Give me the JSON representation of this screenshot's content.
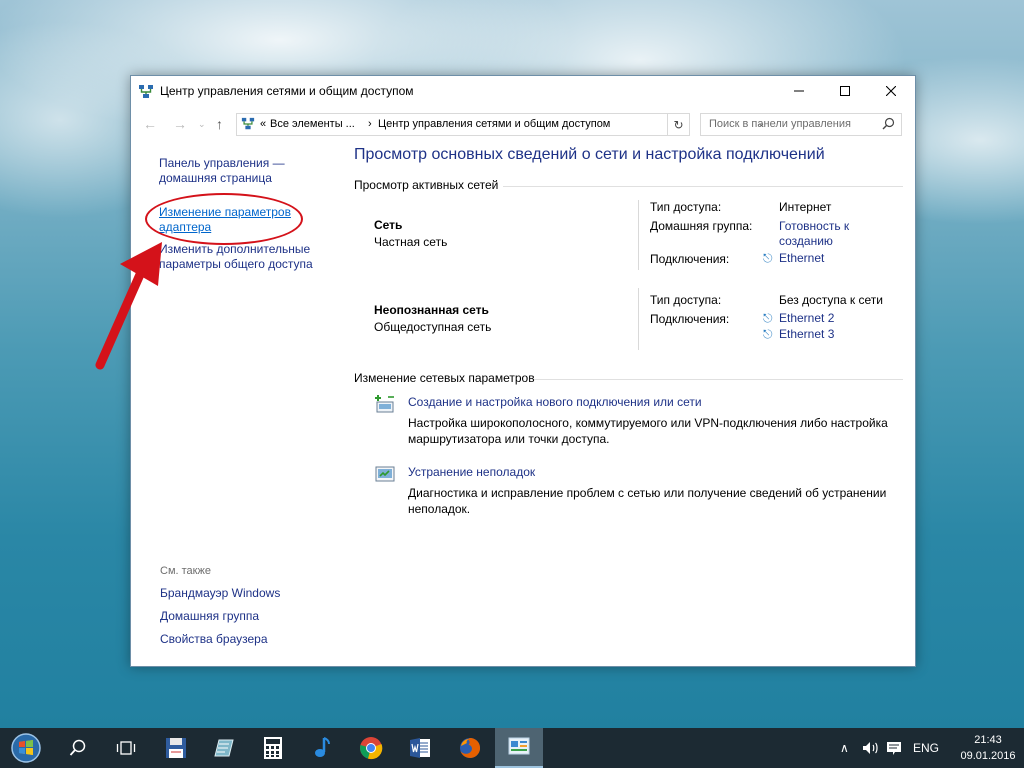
{
  "window": {
    "title": "Центр управления сетями и общим доступом"
  },
  "address": {
    "breadcrumb_prefix": "«",
    "part1": "Все элементы ...",
    "separator": "›",
    "part2": "Центр управления сетями и общим доступом",
    "search_placeholder": "Поиск в панели управления"
  },
  "left_pane": {
    "home_line1": "Панель управления —",
    "home_line2": "домашняя страница",
    "adapter_line1": "Изменение параметров",
    "adapter_line2": "адаптера",
    "sharing_line1": "Изменить дополнительные",
    "sharing_line2": "параметры общего доступа",
    "see_also": "См. также",
    "see_also_items": [
      "Брандмауэр Windows",
      "Домашняя группа",
      "Свойства браузера"
    ]
  },
  "main": {
    "title": "Просмотр основных сведений о сети и настройка подключений",
    "active_networks_heading": "Просмотр активных сетей",
    "networks": [
      {
        "name": "Сеть",
        "type": "Частная сеть",
        "access_label": "Тип доступа:",
        "access_value": "Интернет",
        "homegroup_label": "Домашняя группа:",
        "homegroup_line1": "Готовность к",
        "homegroup_line2": "созданию",
        "connections_label": "Подключения:",
        "connections": [
          "Ethernet"
        ]
      },
      {
        "name": "Неопознанная сеть",
        "type": "Общедоступная сеть",
        "access_label": "Тип доступа:",
        "access_value": "Без доступа к сети",
        "connections_label": "Подключения:",
        "connections": [
          "Ethernet 2",
          "Ethernet 3"
        ]
      }
    ],
    "change_settings_heading": "Изменение сетевых параметров",
    "tasks": [
      {
        "link": "Создание и настройка нового подключения или сети",
        "desc_line1": "Настройка широкополосного, коммутируемого или VPN-подключения либо настройка",
        "desc_line2": "маршрутизатора или точки доступа."
      },
      {
        "link": "Устранение неполадок",
        "desc_line1": "Диагностика и исправление проблем с сетью или получение сведений об устранении",
        "desc_line2": "неполадок."
      }
    ]
  },
  "taskbar": {
    "language": "ENG",
    "time": "21:43",
    "date": "09.01.2016"
  },
  "colors": {
    "link": "#1e3287",
    "accent_red": "#d4121a",
    "taskbar": "#1c2a33"
  }
}
